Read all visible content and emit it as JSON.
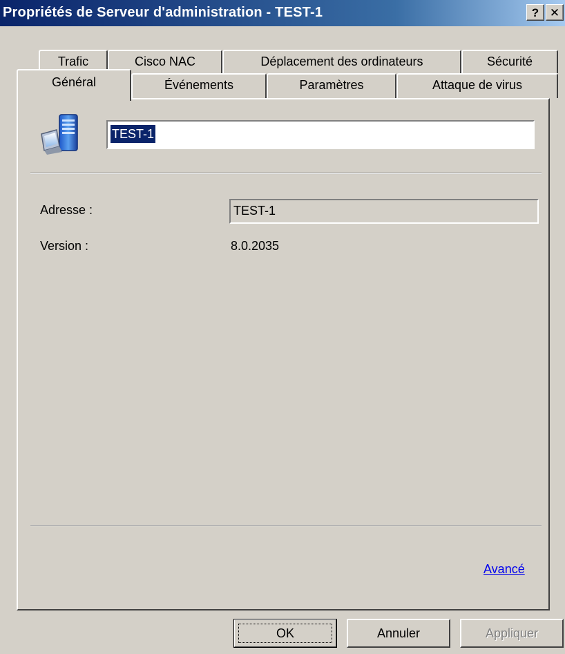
{
  "window": {
    "title": "Propriétés de Serveur d'administration - TEST-1",
    "help_label": "?",
    "close_label": "✕"
  },
  "tabs": {
    "row1": [
      "Trafic",
      "Cisco NAC",
      "Déplacement des ordinateurs",
      "Sécurité"
    ],
    "row2": [
      "Général",
      "Événements",
      "Paramètres",
      "Attaque de virus"
    ],
    "active": "Général"
  },
  "general": {
    "icon": "server-computer-icon",
    "name_value": "TEST-1",
    "address_label": "Adresse :",
    "address_value": "TEST-1",
    "version_label": "Version :",
    "version_value": "8.0.2035",
    "advanced_link": "Avancé"
  },
  "buttons": {
    "ok": "OK",
    "cancel": "Annuler",
    "apply": "Appliquer"
  },
  "colors": {
    "titlebar_start": "#0a246a",
    "titlebar_end": "#a6caf0",
    "face": "#d4d0c8",
    "link": "#0000ee",
    "selection": "#0a246a"
  }
}
